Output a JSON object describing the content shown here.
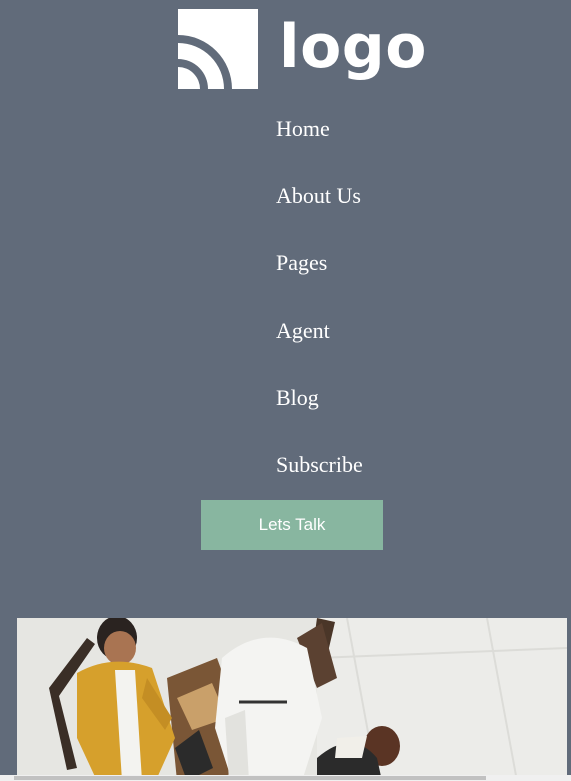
{
  "brand": {
    "logo_text": "logo",
    "logo_icon": "wifi-signal-icon"
  },
  "nav": {
    "items": [
      {
        "label": "Home"
      },
      {
        "label": "About Us"
      },
      {
        "label": "Pages"
      },
      {
        "label": "Agent"
      },
      {
        "label": "Blog"
      },
      {
        "label": "Subscribe"
      }
    ]
  },
  "cta": {
    "label": "Lets Talk"
  },
  "colors": {
    "header_bg": "#616b7a",
    "button_bg": "#88b6a0",
    "text": "#ffffff"
  },
  "hero": {
    "image": "team-meeting-photo"
  }
}
